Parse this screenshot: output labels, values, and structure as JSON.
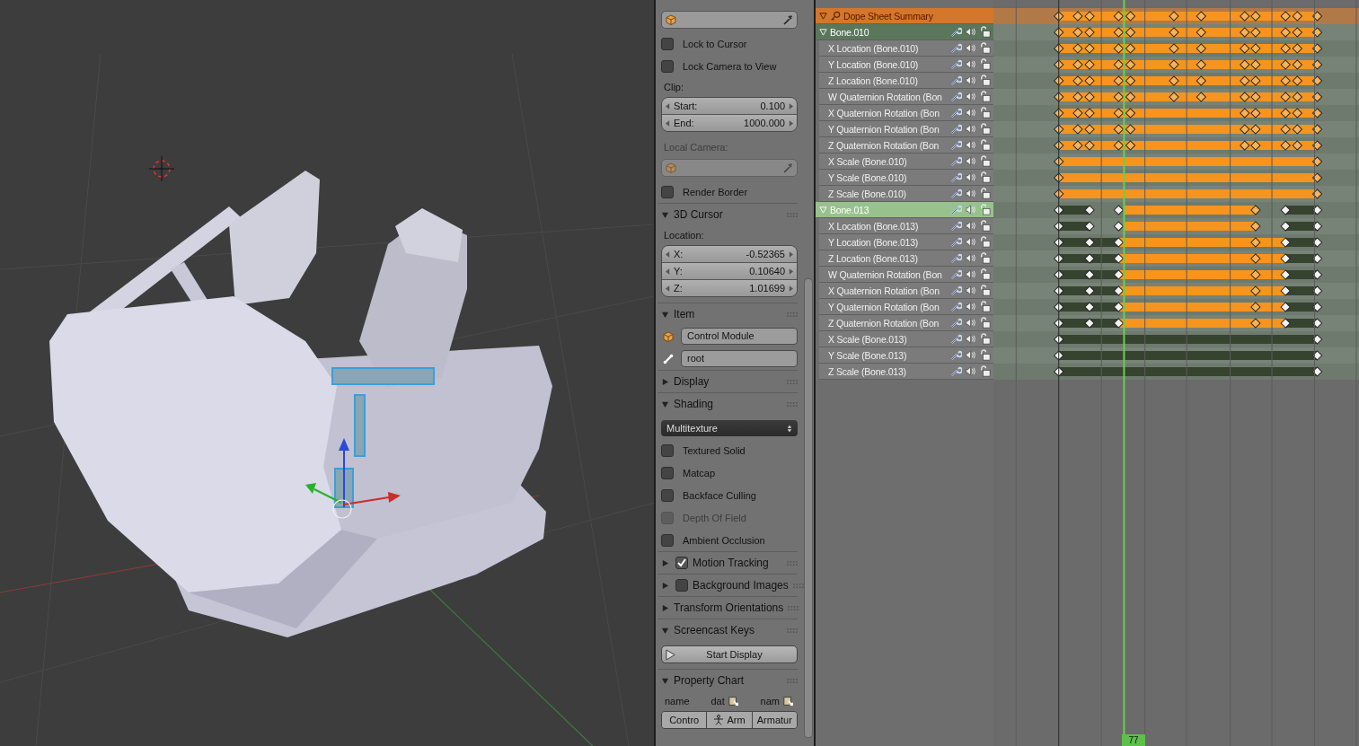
{
  "properties": {
    "items": [
      {
        "kind": "object_field",
        "disabled": false
      },
      {
        "kind": "checkbox",
        "label": "Lock to Cursor",
        "checked": false,
        "disabled": false
      },
      {
        "kind": "checkbox",
        "label": "Lock Camera to View",
        "checked": false,
        "disabled": false
      },
      {
        "kind": "label",
        "label": "Clip:",
        "disabled": false
      },
      {
        "kind": "numbers",
        "fields": [
          {
            "label": "Start:",
            "value": "0.100"
          },
          {
            "label": "End:",
            "value": "1000.000"
          }
        ]
      },
      {
        "kind": "label",
        "label": "Local Camera:",
        "disabled": true
      },
      {
        "kind": "object_field",
        "disabled": true
      },
      {
        "kind": "checkbox",
        "label": "Render Border",
        "checked": false,
        "disabled": false
      },
      {
        "kind": "panel",
        "label": "3D Cursor",
        "expanded": true
      },
      {
        "kind": "label",
        "label": "Location:",
        "disabled": false
      },
      {
        "kind": "numbers",
        "fields": [
          {
            "label": "X:",
            "value": "-0.52365"
          },
          {
            "label": "Y:",
            "value": "0.10640"
          },
          {
            "label": "Z:",
            "value": "1.01699"
          }
        ]
      },
      {
        "kind": "panel",
        "label": "Item",
        "expanded": true
      },
      {
        "kind": "object_name",
        "value": "Control Module"
      },
      {
        "kind": "bone_name",
        "value": "root"
      },
      {
        "kind": "panel",
        "label": "Display",
        "expanded": false
      },
      {
        "kind": "panel",
        "label": "Shading",
        "expanded": true
      },
      {
        "kind": "dropdown",
        "value": "Multitexture"
      },
      {
        "kind": "checkbox",
        "label": "Textured Solid",
        "checked": false,
        "disabled": false
      },
      {
        "kind": "checkbox",
        "label": "Matcap",
        "checked": false,
        "disabled": false
      },
      {
        "kind": "checkbox",
        "label": "Backface Culling",
        "checked": false,
        "disabled": false
      },
      {
        "kind": "checkbox",
        "label": "Depth Of Field",
        "checked": false,
        "disabled": true
      },
      {
        "kind": "checkbox",
        "label": "Ambient Occlusion",
        "checked": false,
        "disabled": false
      },
      {
        "kind": "panel",
        "label": "Motion Tracking",
        "expanded": false,
        "checked": true
      },
      {
        "kind": "panel",
        "label": "Background Images",
        "expanded": false,
        "checked": false
      },
      {
        "kind": "panel",
        "label": "Transform Orientations",
        "expanded": false
      },
      {
        "kind": "panel",
        "label": "Screencast Keys",
        "expanded": true
      },
      {
        "kind": "button",
        "label": "Start Display"
      },
      {
        "kind": "panel",
        "label": "Property Chart",
        "expanded": true
      },
      {
        "kind": "chart_header",
        "columns": [
          {
            "text": "name",
            "icon": false
          },
          {
            "text": "dat",
            "icon": true
          },
          {
            "text": "nam",
            "icon": true
          }
        ]
      },
      {
        "kind": "chart_row",
        "cells": [
          {
            "text": "Contro",
            "icon": false
          },
          {
            "text": "Arm",
            "icon": true
          },
          {
            "text": "Armatur",
            "icon": false
          }
        ]
      }
    ]
  },
  "dope_sheet": {
    "current_frame": "77",
    "channels": [
      {
        "kind": "summary",
        "label": "Dope Sheet Summary",
        "expanded": true
      },
      {
        "kind": "group",
        "label": "Bone.010",
        "expanded": true,
        "selected": false
      },
      {
        "kind": "channel",
        "label": "X Location (Bone.010)"
      },
      {
        "kind": "channel",
        "label": "Y Location (Bone.010)"
      },
      {
        "kind": "channel",
        "label": "Z Location (Bone.010)"
      },
      {
        "kind": "channel",
        "label": "W Quaternion Rotation (Bon"
      },
      {
        "kind": "channel",
        "label": "X Quaternion Rotation (Bon"
      },
      {
        "kind": "channel",
        "label": "Y Quaternion Rotation (Bon"
      },
      {
        "kind": "channel",
        "label": "Z Quaternion Rotation (Bon"
      },
      {
        "kind": "channel",
        "label": "X Scale (Bone.010)"
      },
      {
        "kind": "channel",
        "label": "Y Scale (Bone.010)"
      },
      {
        "kind": "channel",
        "label": "Z Scale (Bone.010)"
      },
      {
        "kind": "group",
        "label": "Bone.013",
        "expanded": true,
        "selected": true
      },
      {
        "kind": "channel",
        "label": "X Location (Bone.013)"
      },
      {
        "kind": "channel",
        "label": "Y Location (Bone.013)"
      },
      {
        "kind": "channel",
        "label": "Z Location (Bone.013)"
      },
      {
        "kind": "channel",
        "label": "W Quaternion Rotation (Bon"
      },
      {
        "kind": "channel",
        "label": "X Quaternion Rotation (Bon"
      },
      {
        "kind": "channel",
        "label": "Y Quaternion Rotation (Bon"
      },
      {
        "kind": "channel",
        "label": "Z Quaternion Rotation (Bon"
      },
      {
        "kind": "channel",
        "label": "X Scale (Bone.013)"
      },
      {
        "kind": "channel",
        "label": "Y Scale (Bone.013)"
      },
      {
        "kind": "channel",
        "label": "Z Scale (Bone.013)"
      }
    ]
  }
}
